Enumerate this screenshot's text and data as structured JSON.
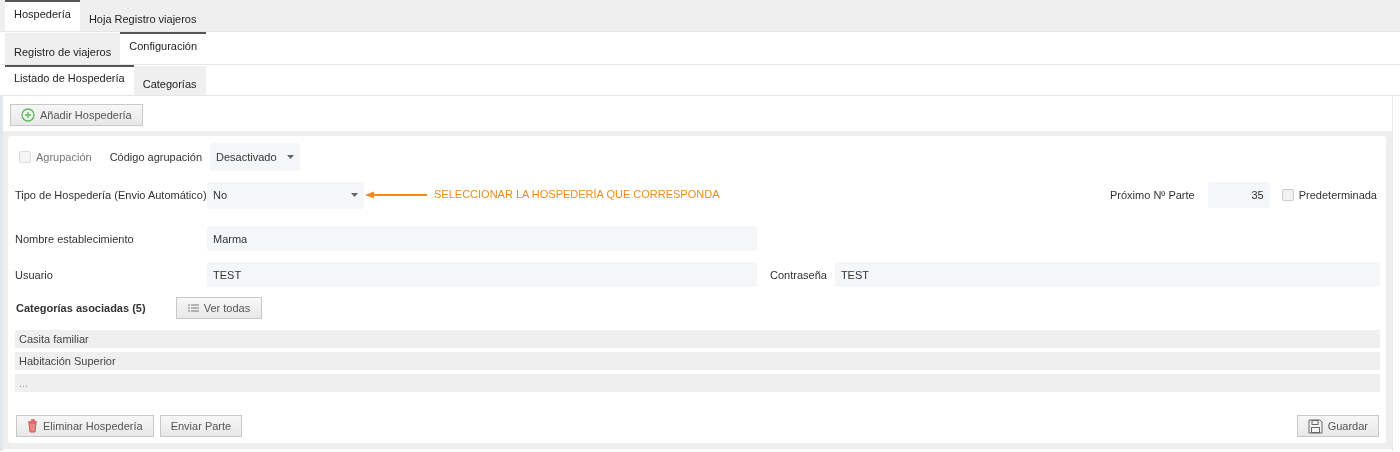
{
  "top_tabs": [
    {
      "label": "Hospedería",
      "selected": true
    },
    {
      "label": "Hoja Registro viajeros",
      "selected": false
    }
  ],
  "sub_tabs": [
    {
      "label": "Registro de viajeros",
      "selected": false
    },
    {
      "label": "Configuración",
      "selected": true
    }
  ],
  "section_tabs": [
    {
      "label": "Listado de Hospedería",
      "selected": true
    },
    {
      "label": "Categorías",
      "selected": false
    }
  ],
  "add_button": {
    "label": "Añadir Hospedería"
  },
  "form": {
    "grouping": {
      "label": "Agrupación",
      "checked": false,
      "disabled": true
    },
    "group_code": {
      "label": "Código agrupación",
      "value": "Desactivado"
    },
    "type": {
      "label": "Tipo de Hospedería (Envio Automático)",
      "value": "No"
    },
    "annotation": {
      "text": "SELECCIONAR LA HOSPEDERÍA QUE CORRESPONDA"
    },
    "next_part": {
      "label": "Próximo Nº Parte",
      "value": "35"
    },
    "default": {
      "label": "Predeterminada",
      "checked": false
    },
    "name": {
      "label": "Nombre establecimiento",
      "value": "Marma"
    },
    "user": {
      "label": "Usuario",
      "value": "TEST"
    },
    "password": {
      "label": "Contraseña",
      "value": "TEST"
    }
  },
  "categories": {
    "title": "Categorías asociadas (5)",
    "view_all": "Ver todas",
    "items": [
      "Casita familiar",
      "Habitación Superior",
      "..."
    ]
  },
  "actions": [
    {
      "label": "Eliminar Hospedería",
      "kind": "delete"
    },
    {
      "label": "Enviar Parte",
      "kind": "send"
    },
    {
      "label": "Guardar",
      "kind": "save"
    }
  ]
}
